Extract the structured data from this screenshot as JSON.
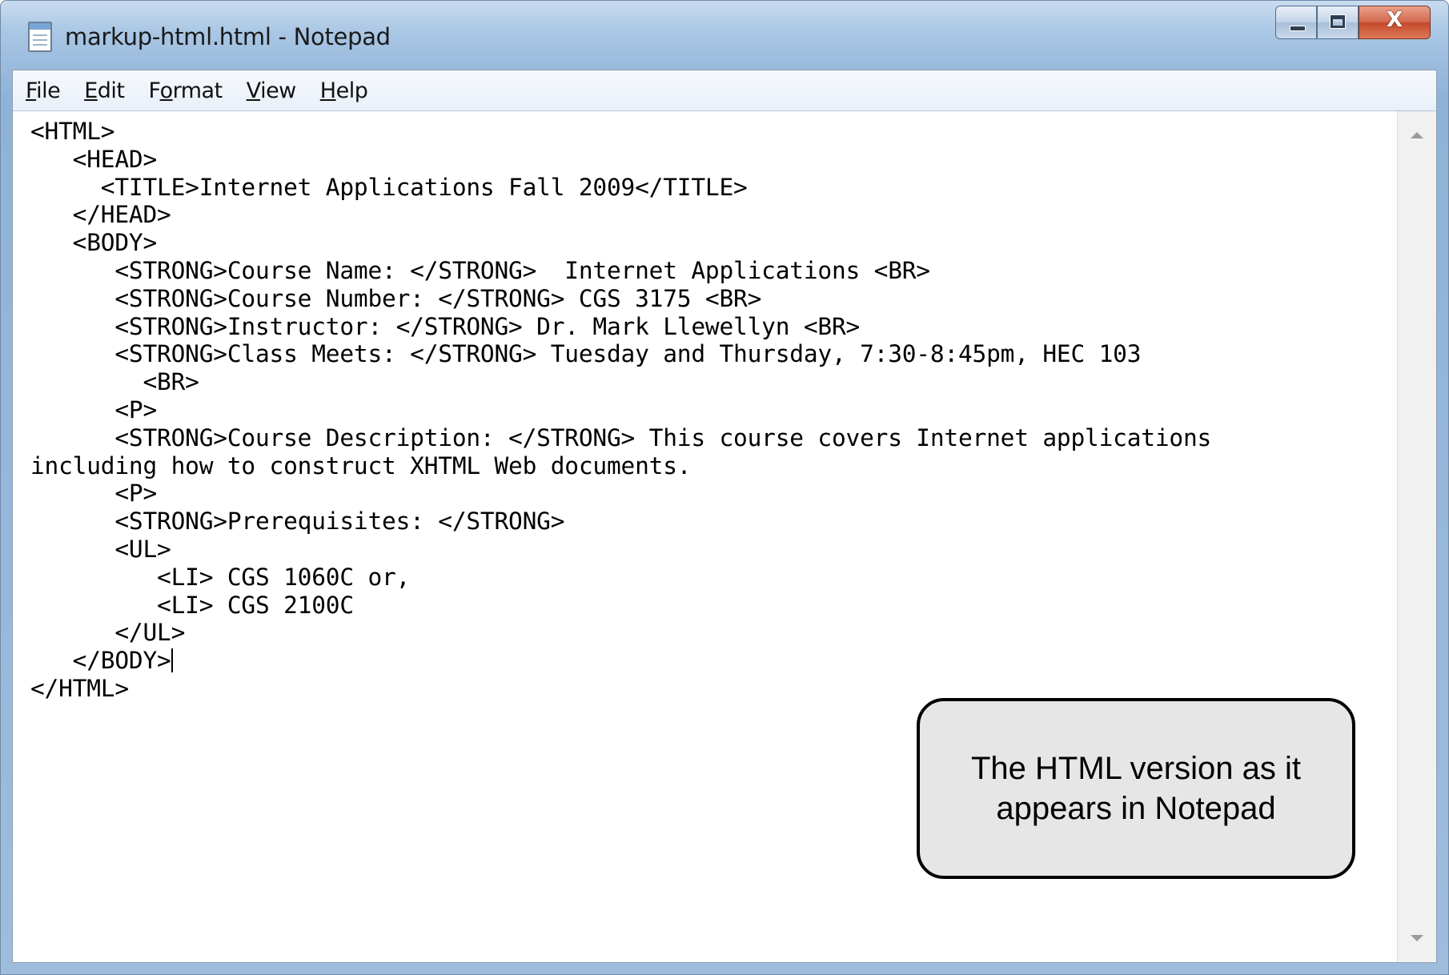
{
  "window": {
    "title": "markup-html.html - Notepad",
    "close_glyph": "X"
  },
  "menu": {
    "items": [
      {
        "accel": "F",
        "rest": "ile"
      },
      {
        "accel": "E",
        "rest": "dit"
      },
      {
        "pre": "F",
        "accel": "o",
        "rest": "rmat"
      },
      {
        "accel": "V",
        "rest": "iew"
      },
      {
        "accel": "H",
        "rest": "elp"
      }
    ]
  },
  "editor": {
    "lines": [
      "<HTML>",
      "   <HEAD>",
      "     <TITLE>Internet Applications Fall 2009</TITLE>",
      "   </HEAD>",
      "   <BODY>",
      "      <STRONG>Course Name: </STRONG>  Internet Applications <BR>",
      "      <STRONG>Course Number: </STRONG> CGS 3175 <BR>",
      "      <STRONG>Instructor: </STRONG> Dr. Mark Llewellyn <BR>",
      "      <STRONG>Class Meets: </STRONG> Tuesday and Thursday, 7:30-8:45pm, HEC 103",
      "        <BR>",
      "      <P>",
      "      <STRONG>Course Description: </STRONG> This course covers Internet applications",
      "including how to construct XHTML Web documents.",
      "      <P>",
      "      <STRONG>Prerequisites: </STRONG>",
      "      <UL>",
      "         <LI> CGS 1060C or,",
      "         <LI> CGS 2100C",
      "      </UL>",
      "   </BODY>",
      "</HTML>"
    ]
  },
  "callout": {
    "text": "The HTML version as it appears in Notepad"
  },
  "colors": {
    "titlebar": "#a9c6e4",
    "close_button": "#c44a2c",
    "callout_fill": "#e6e6e6"
  },
  "icons": [
    "notepad-icon",
    "minimize-icon",
    "maximize-icon",
    "close-icon",
    "scroll-up-arrow-icon",
    "scroll-down-arrow-icon"
  ]
}
